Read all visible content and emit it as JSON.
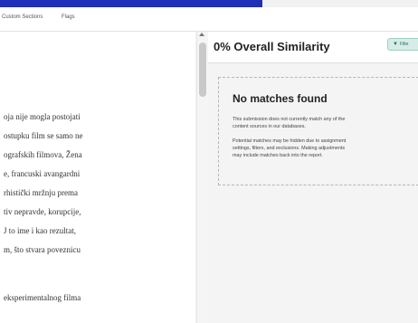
{
  "toolbar": {
    "items": [
      "Custom Sections",
      "Flags"
    ]
  },
  "document": {
    "lines": [
      "oja nije mogla postojati",
      "ostupku film se samo ne",
      "ografskih filmova, Žena",
      "e, francuski avangardni",
      "rhistički mržnju prema",
      "tiv nepravde, korupcije,",
      "J to ime i kao rezultat,",
      "m, što stvara poveznicu",
      "eksperimentalnog filma"
    ]
  },
  "panel": {
    "title": "0% Overall Similarity",
    "filter_label": "Filte",
    "no_match": {
      "title": "No matches found",
      "line1a": "This submission does not currently match any of the",
      "line1b": "content sources in our databases.",
      "line2a": "Potential matches may be hidden due to assignment",
      "line2b": "settings, filters, and exclusions. Making adjustments",
      "line2c": "may include matches back into the report."
    }
  },
  "colors": {
    "accent_blue": "#1f2fb6",
    "filter_bg": "#d7ece6"
  }
}
